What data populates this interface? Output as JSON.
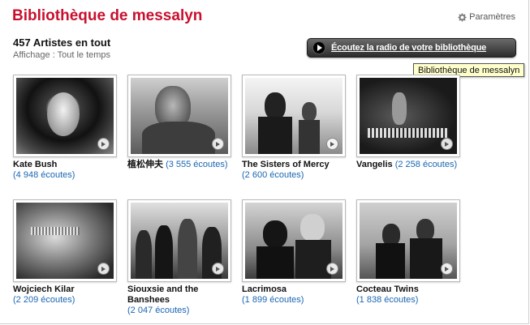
{
  "page": {
    "title": "Bibliothèque de messalyn",
    "settings_label": "Paramètres",
    "artist_count": "457 Artistes en tout",
    "period": "Affichage : Tout le temps",
    "radio_button_label": "Écoutez la radio de votre bibliothèque",
    "tooltip": "Bibliothèque de messalyn"
  },
  "artists": [
    {
      "name": "Kate Bush",
      "plays": "(4 948 écoutes)"
    },
    {
      "name": "植松伸夫",
      "plays": "(3 555 écoutes)"
    },
    {
      "name": "The Sisters of Mercy",
      "plays": "(2 600 écoutes)"
    },
    {
      "name": "Vangelis",
      "plays": "(2 258 écoutes)"
    },
    {
      "name": "Wojciech Kilar",
      "plays": "(2 209 écoutes)"
    },
    {
      "name": "Siouxsie and the Banshees",
      "plays": "(2 047 écoutes)"
    },
    {
      "name": "Lacrimosa",
      "plays": "(1 899 écoutes)"
    },
    {
      "name": "Cocteau Twins",
      "plays": "(1 838 écoutes)"
    }
  ],
  "colors": {
    "title": "#c8102e",
    "link": "#1a66b3"
  },
  "icons": {
    "settings": "gear-icon",
    "radio": "play-icon"
  }
}
